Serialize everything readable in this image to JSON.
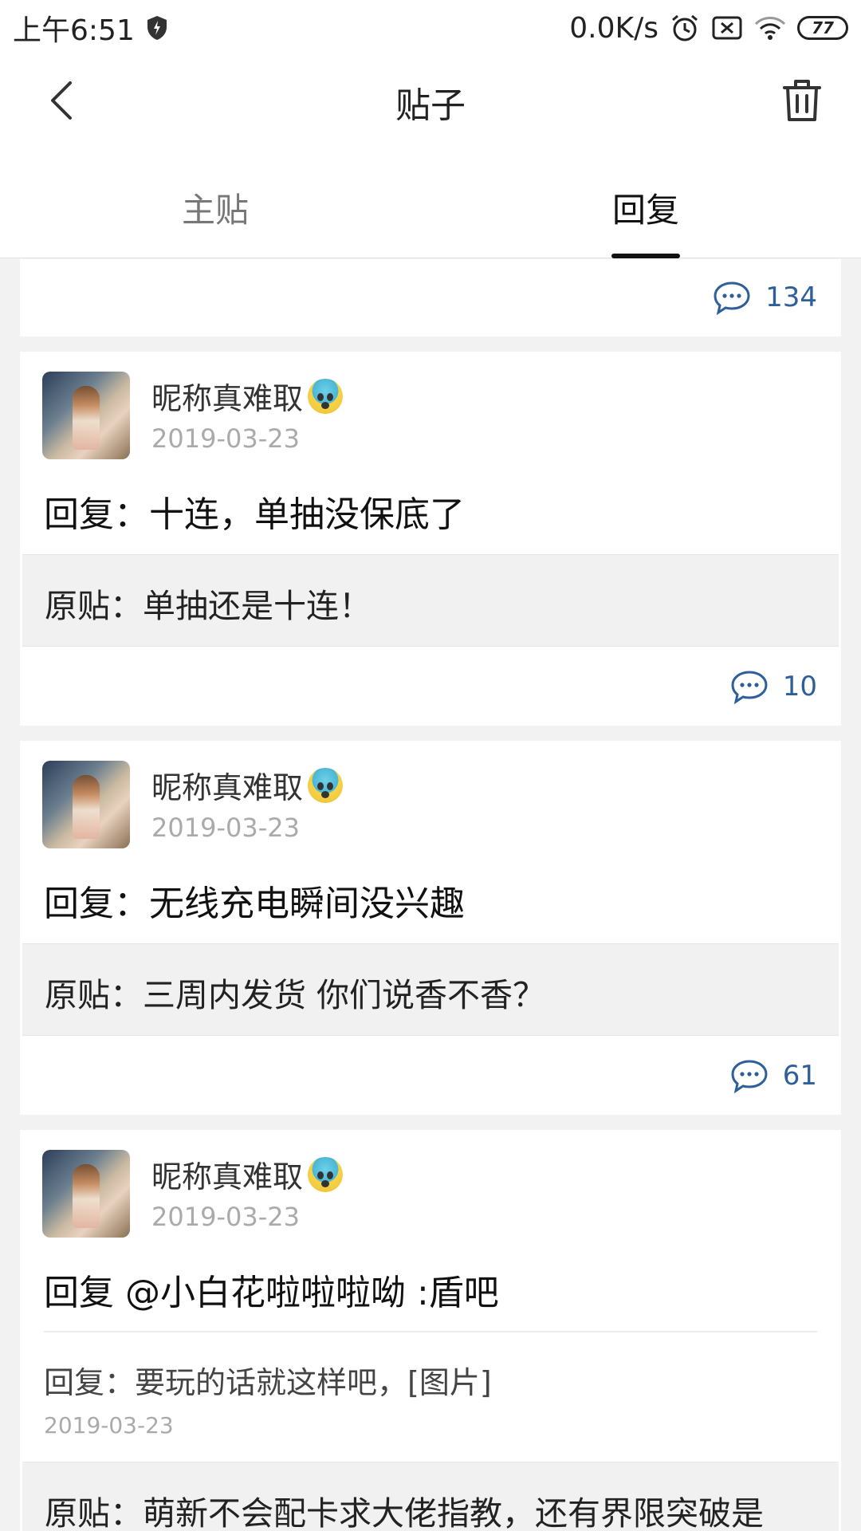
{
  "status_bar": {
    "time": "上午6:51",
    "network_speed": "0.0K/s",
    "battery": "77",
    "icons": [
      "shield-icon",
      "alarm-icon",
      "sim-off-icon",
      "wifi-icon",
      "battery-icon"
    ]
  },
  "header": {
    "title": "贴子",
    "back_icon": "chevron-left-icon",
    "delete_icon": "trash-icon"
  },
  "tabs": [
    {
      "label": "主贴",
      "active": false
    },
    {
      "label": "回复",
      "active": true
    }
  ],
  "top_card": {
    "count": "134"
  },
  "posts": [
    {
      "username": "昵称真难取",
      "date": "2019-03-23",
      "reply": "回复：十连，单抽没保底了",
      "original": "原贴：单抽还是十连！",
      "count": "10"
    },
    {
      "username": "昵称真难取",
      "date": "2019-03-23",
      "reply": "回复：无线充电瞬间没兴趣",
      "original": "原贴：三周内发货 你们说香不香？",
      "count": "61"
    },
    {
      "username": "昵称真难取",
      "date": "2019-03-23",
      "reply": "回复 @小白花啦啦啦呦 :盾吧",
      "sub_reply": "回复：要玩的话就这样吧，[图片]",
      "sub_date": "2019-03-23",
      "original": "原贴：萌新不会配卡求大佬指教，还有界限突破是"
    }
  ],
  "colors": {
    "accent": "#2f5f9a",
    "background": "#f2f2f2",
    "quote_background": "#f1f1f1"
  }
}
